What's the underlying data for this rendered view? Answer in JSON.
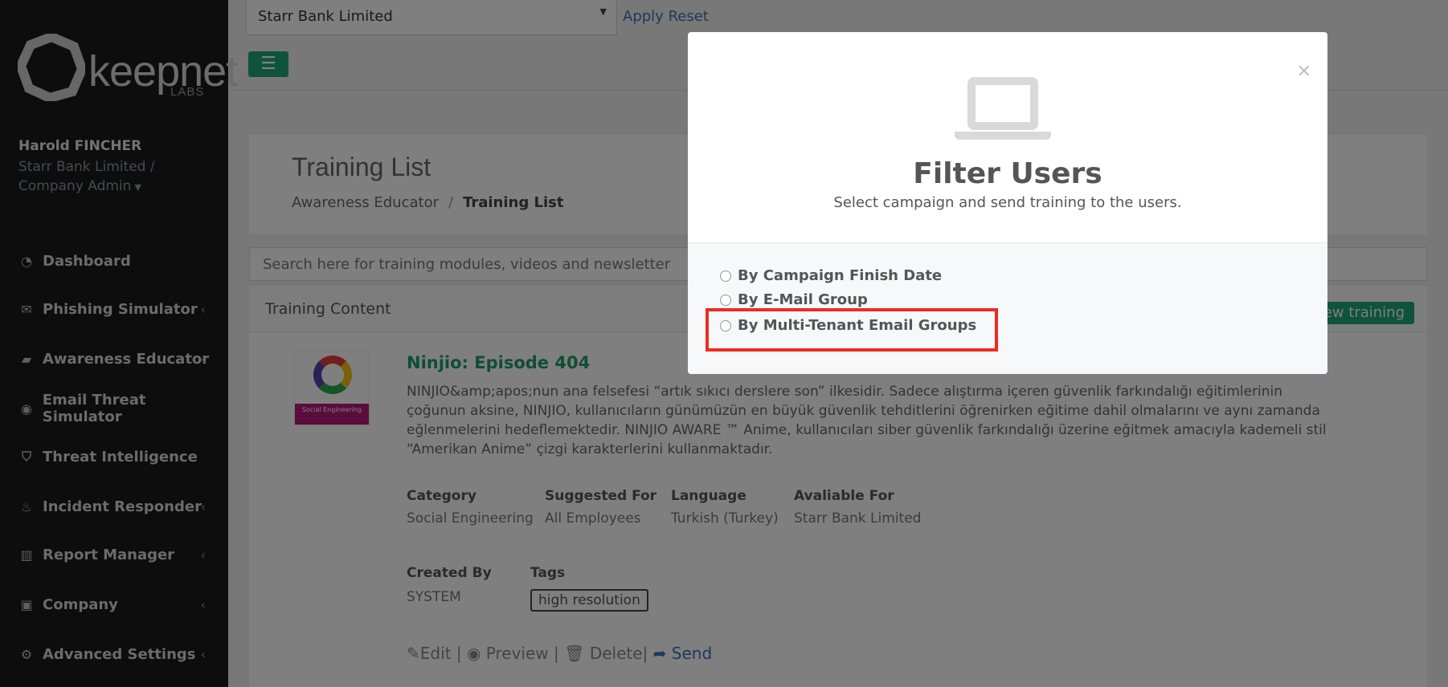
{
  "sidebar": {
    "logo_word": "keepnet",
    "logo_sub": "LABS",
    "user_name": "Harold FINCHER",
    "user_org": "Starr Bank Limited / Company Admin",
    "nav": [
      {
        "label": "Dashboard",
        "icon": "dashboard-icon",
        "has_submenu": false
      },
      {
        "label": "Phishing Simulator",
        "icon": "envelope-icon",
        "has_submenu": true
      },
      {
        "label": "Awareness Educator",
        "icon": "book-icon",
        "has_submenu": true
      },
      {
        "label": "Email Threat Simulator",
        "icon": "globe-icon",
        "has_submenu": false
      },
      {
        "label": "Threat Intelligence",
        "icon": "shield-icon",
        "has_submenu": false
      },
      {
        "label": "Incident Responder",
        "icon": "fire-icon",
        "has_submenu": true
      },
      {
        "label": "Report Manager",
        "icon": "bar-chart-icon",
        "has_submenu": true
      },
      {
        "label": "Company",
        "icon": "briefcase-icon",
        "has_submenu": true
      },
      {
        "label": "Advanced Settings",
        "icon": "gears-icon",
        "has_submenu": true
      }
    ]
  },
  "topbar": {
    "company_select": "Starr Bank Limited",
    "apply": "Apply",
    "reset": "Reset"
  },
  "page": {
    "title": "Training List",
    "breadcrumb_parent": "Awareness Educator",
    "breadcrumb_current": "Training List",
    "search_placeholder": "Search here for training modules, videos and newsletter",
    "content_title": "Training Content",
    "new_training": "New training"
  },
  "module": {
    "thumb_text": "Social Engineering",
    "title": "Ninjio: Episode 404",
    "description": "NINJIO&amp;apos;nun ana felsefesi “artık sıkıcı derslere son” ilkesidir. Sadece alıştırma içeren güvenlik farkındalığı eğitimlerinin çoğunun aksine, NINJIO, kullanıcıların günümüzün en büyük güvenlik tehditlerini öğrenirken eğitime dahil olmalarını ve aynı zamanda eğlenmelerini hedeflemektedir. NINJIO AWARE ™ Anime, kullanıcıları siber güvenlik farkındalığı üzerine eğitmek amacıyla kademeli stil “Amerikan Anime” çizgi karakterlerini kullanmaktadır.",
    "category_label": "Category",
    "category": "Social Engineering",
    "suggested_label": "Suggested For",
    "suggested": "All Employees",
    "language_label": "Language",
    "language": "Turkish (Turkey)",
    "available_label": "Avaliable For",
    "available": "Starr Bank Limited",
    "created_label": "Created By",
    "created": "SYSTEM",
    "tags_label": "Tags",
    "tag": "high resolution",
    "actions": {
      "edit": "Edit",
      "preview": "Preview",
      "delete": "Delete",
      "send": "Send"
    }
  },
  "modal": {
    "title": "Filter Users",
    "subtitle": "Select campaign and send training to the users.",
    "close": "×",
    "options": [
      "By Campaign Finish Date",
      "By E-Mail Group",
      "By Multi-Tenant Email Groups"
    ]
  },
  "colors": {
    "accent_green": "#1fa67a",
    "link_blue": "#3b73b9",
    "highlight_red": "#ee2b20"
  }
}
